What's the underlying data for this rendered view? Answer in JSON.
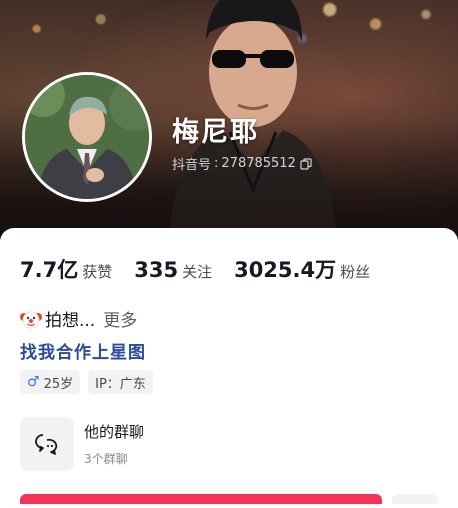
{
  "profile": {
    "nickname": "梅尼耶",
    "id_label": "抖音号",
    "id_sep": ":",
    "id_value": "278785512"
  },
  "stats": [
    {
      "value": "7.7亿",
      "label": "获赞"
    },
    {
      "value": "335",
      "label": "关注"
    },
    {
      "value": "3025.4万",
      "label": "粉丝"
    }
  ],
  "bio": {
    "text": "拍想...",
    "more": "更多",
    "link": "找我合作上星图"
  },
  "tags": {
    "age": "25岁",
    "ip": "IP：广东"
  },
  "group": {
    "title": "他的群聊",
    "subtitle": "3个群聊"
  },
  "colors": {
    "accent_red": "#f23557",
    "link_blue": "#2a4a9a",
    "male_blue": "#2f7be8"
  },
  "icons": [
    "copy-icon",
    "clown-emoji-icon",
    "male-icon",
    "group-chat-icon"
  ]
}
